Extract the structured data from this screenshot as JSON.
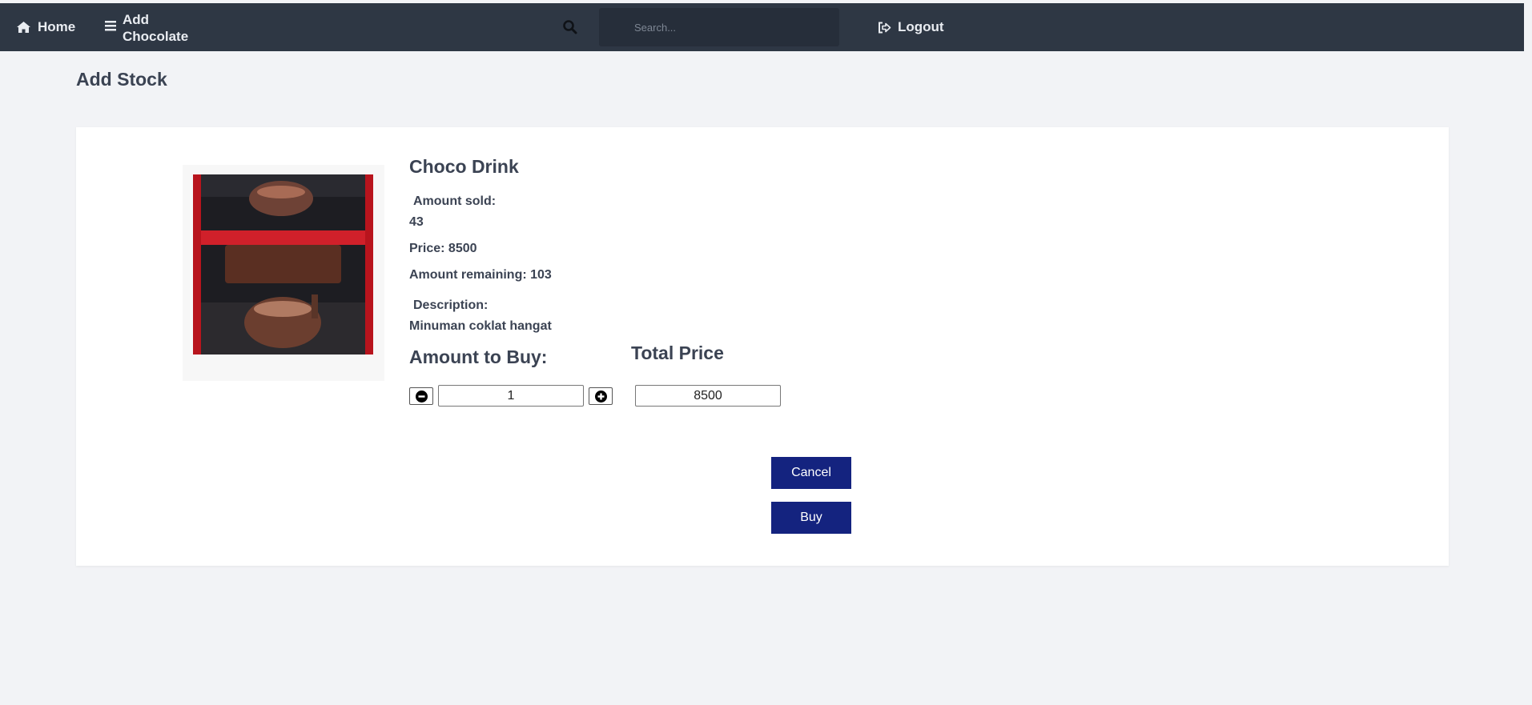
{
  "nav": {
    "home_label": "Home",
    "add_label_line1": "Add",
    "add_label_line2": "Chocolate",
    "logout_label": "Logout",
    "search_placeholder": "Search..."
  },
  "page": {
    "title": "Add Stock"
  },
  "product": {
    "image_icon": "product-photo",
    "name": "Choco Drink",
    "amount_sold_label": "Amount sold:",
    "amount_sold": "43",
    "price_text": "Price: 8500",
    "remaining_text": "Amount remaining: 103",
    "description_label": "Description:",
    "description": "Minuman coklat hangat"
  },
  "purchase": {
    "amount_label": "Amount to Buy:",
    "total_label": "Total Price",
    "quantity": "1",
    "total": "8500"
  },
  "actions": {
    "cancel_label": "Cancel",
    "buy_label": "Buy"
  },
  "colors": {
    "topbar": "#2e3744",
    "primary_button": "#14237f",
    "page_bg": "#f2f3f6"
  }
}
